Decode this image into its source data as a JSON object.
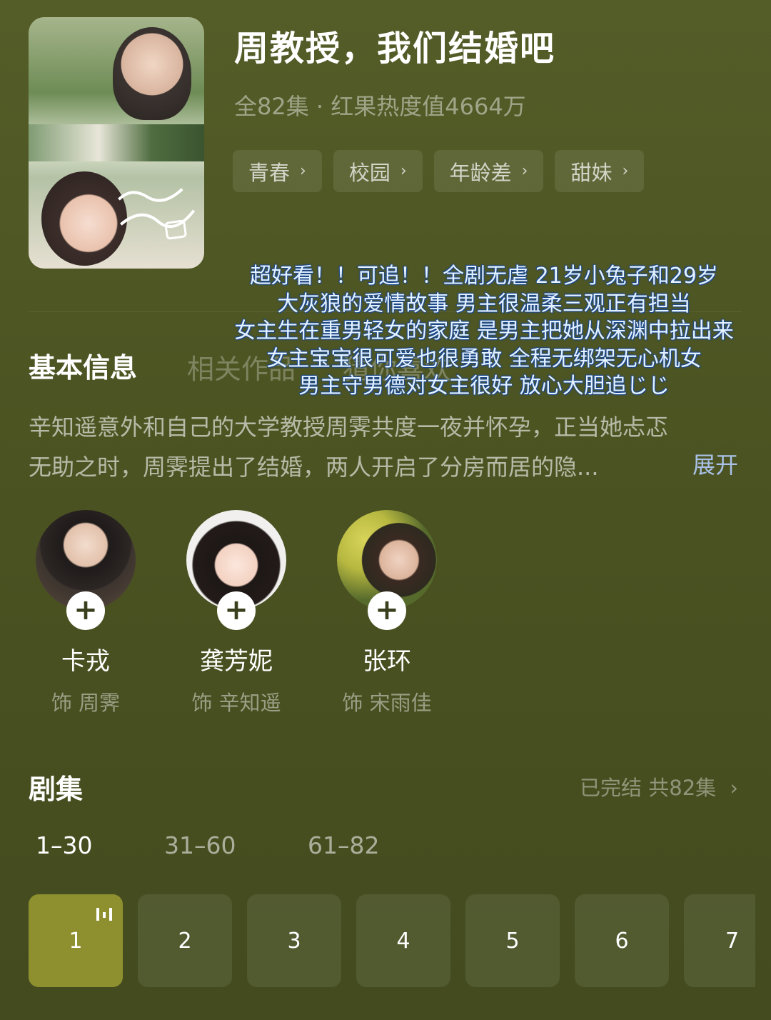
{
  "show": {
    "title": "周教授，我们结婚吧",
    "meta": "全82集 · 红果热度值4664万",
    "poster_script": "周教授，我们结婚吧",
    "tags": [
      {
        "label": "青春"
      },
      {
        "label": "校园"
      },
      {
        "label": "年龄差"
      },
      {
        "label": "甜妹"
      }
    ]
  },
  "overlay_text": [
    "超好看！！可追！！全剧无虐 21岁小兔子和29岁",
    "大灰狼的爱情故事 男主很温柔三观正有担当",
    "女主生在重男轻女的家庭 是男主把她从深渊中拉出来",
    "女主宝宝很可爱也很勇敢 全程无绑架无心机女",
    "男主守男德对女主很好 放心大胆追じじ"
  ],
  "tabs": {
    "basic": "基本信息",
    "related": "相关作品",
    "guess": "猜你喜欢"
  },
  "synopsis": {
    "line1": "辛知遥意外和自己的大学教授周霁共度一夜并怀孕，正当她忐忑",
    "line2": "无助之时，周霁提出了结婚，两人开启了分房而居的隐...",
    "expand": "展开"
  },
  "cast": [
    {
      "name": "卡戎",
      "role": "饰 周霁"
    },
    {
      "name": "龚芳妮",
      "role": "饰 辛知遥"
    },
    {
      "name": "张环",
      "role": "饰 宋雨佳"
    }
  ],
  "episodes": {
    "title": "剧集",
    "status": "已完结 共82集",
    "ranges": [
      "1–30",
      "31–60",
      "61–82"
    ],
    "active_range": 0,
    "items": [
      "1",
      "2",
      "3",
      "4",
      "5",
      "6",
      "7"
    ],
    "active_episode": "1"
  },
  "icons": {
    "tag_arrow": "chevron-right-icon",
    "follow": "plus-icon",
    "playing": "playing-bars-icon",
    "status_arrow": "chevron-right-icon"
  },
  "colors": {
    "background": "#4b5322",
    "active_episode": "#8e902f",
    "expand_link": "#a9c1e8"
  }
}
